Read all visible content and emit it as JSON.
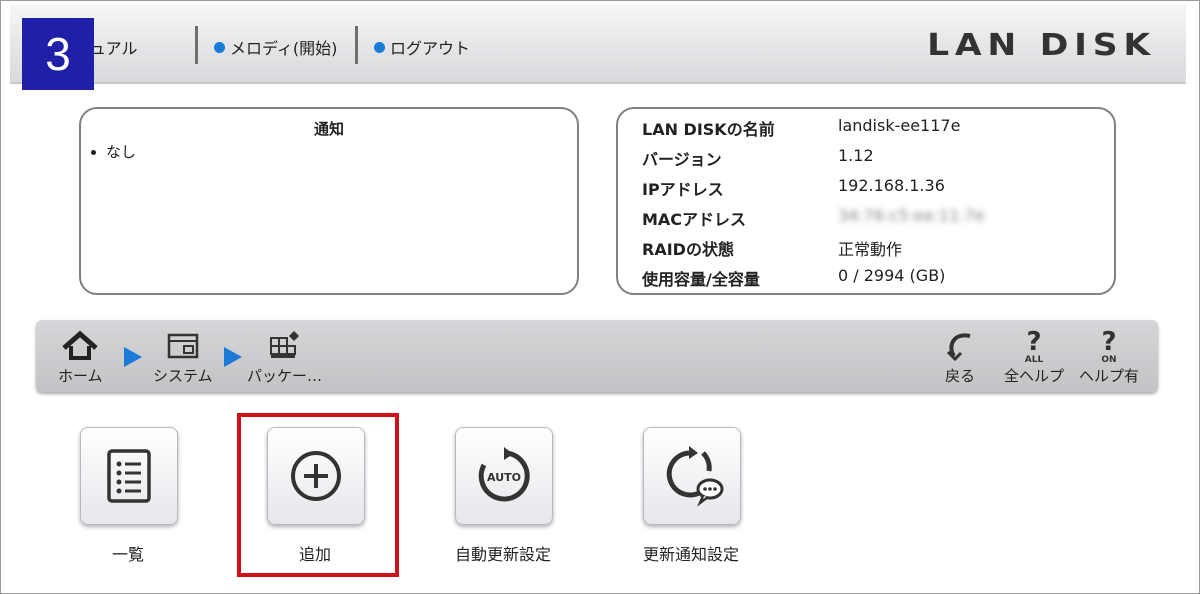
{
  "step_number": "3",
  "header": {
    "manual_link": "ュアル",
    "melody_link": "メロディ(開始)",
    "logout_link": "ログアウト",
    "logo": "LAN DISK",
    "link_dot_color": "#1a7ad6"
  },
  "notice": {
    "title": "通知",
    "items": [
      "なし"
    ]
  },
  "status": {
    "rows": [
      {
        "label": "LAN DISKの名前",
        "value": "landisk-ee117e"
      },
      {
        "label": "バージョン",
        "value": "1.12"
      },
      {
        "label": "IPアドレス",
        "value": "192.168.1.36"
      },
      {
        "label": "MACアドレス",
        "value": "34:76:c5:ee:11:7e"
      },
      {
        "label": "RAIDの状態",
        "value": "正常動作"
      },
      {
        "label": "使用容量/全容量",
        "value": "0 / 2994 (GB)"
      }
    ]
  },
  "toolbar": {
    "breadcrumb": [
      {
        "label": "ホーム",
        "icon": "home-icon"
      },
      {
        "label": "システム",
        "icon": "system-window-icon"
      },
      {
        "label": "パッケー…",
        "icon": "package-icon"
      }
    ],
    "actions": [
      {
        "label": "戻る",
        "icon": "back-arrow-icon"
      },
      {
        "label": "全ヘルプ",
        "icon": "help-all-icon",
        "sub": "ALL"
      },
      {
        "label": "ヘルプ有",
        "icon": "help-on-icon",
        "sub": "ON"
      }
    ],
    "arrow_color": "#1a7ad6"
  },
  "tiles": [
    {
      "label": "一覧",
      "icon": "list-icon"
    },
    {
      "label": "追加",
      "icon": "add-circle-icon"
    },
    {
      "label": "自動更新設定",
      "icon": "auto-update-icon",
      "badge": "AUTO"
    },
    {
      "label": "更新通知設定",
      "icon": "update-notify-icon"
    }
  ],
  "highlight_color": "#d0101b"
}
